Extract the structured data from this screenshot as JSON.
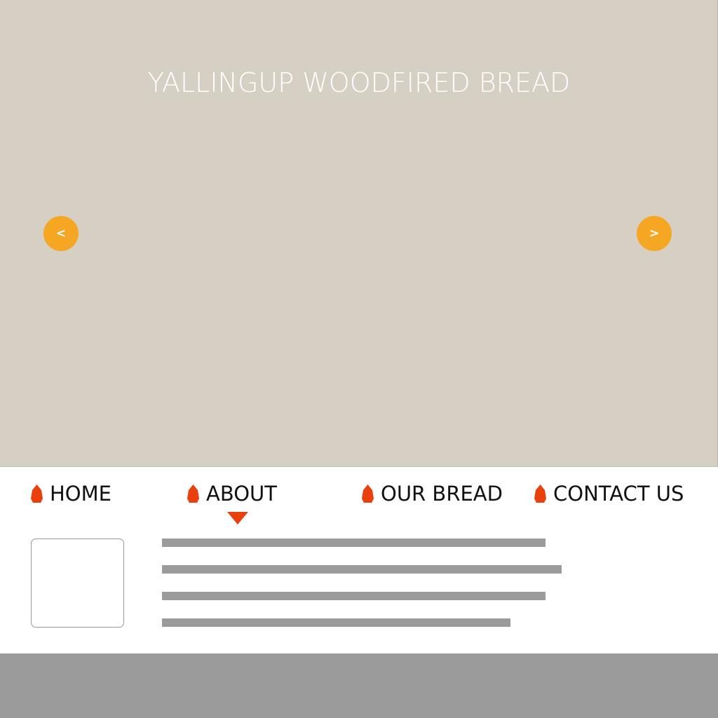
{
  "hero": {
    "title": "YALLINGUP WOODFIRED BREAD",
    "background_color": "#d6d0c4",
    "prev_label": "<",
    "next_label": ">",
    "arrow_color": "#f5a623"
  },
  "nav": {
    "accent_color": "#e8400f",
    "icon": "flame-icon",
    "items": [
      {
        "label": "HOME",
        "active": false
      },
      {
        "label": "ABOUT",
        "active": true
      },
      {
        "label": "OUR BREAD",
        "active": false
      },
      {
        "label": "CONTACT US",
        "active": false
      }
    ]
  },
  "footer": {
    "background_color": "#9b9b9b"
  }
}
